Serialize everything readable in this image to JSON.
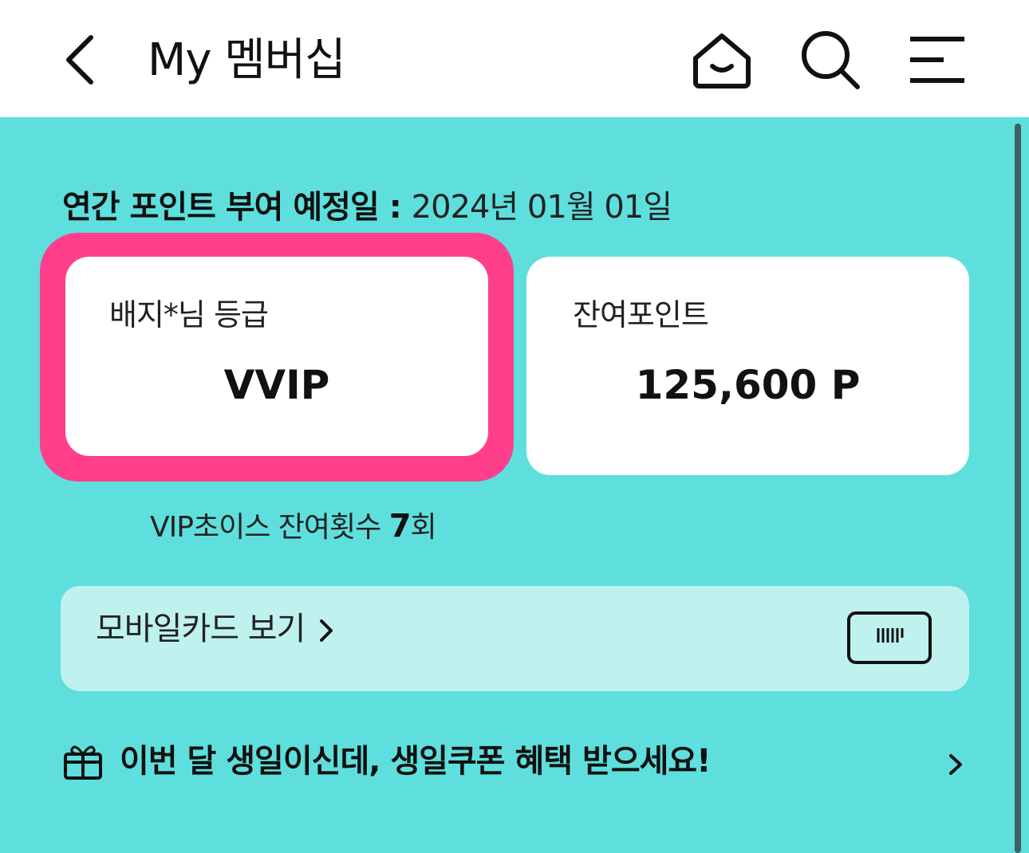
{
  "header": {
    "title": "My 멤버십",
    "back_icon": "chevron-left-icon",
    "home_icon": "home-icon",
    "search_icon": "search-icon",
    "menu_icon": "hamburger-menu-icon"
  },
  "schedule": {
    "label": "연간 포인트 부여 예정일 : ",
    "date": "2024년 01월 01일"
  },
  "grade_card": {
    "label": "배지*님 등급",
    "value": "VVIP",
    "highlight_color": "#ff3f8c"
  },
  "points_card": {
    "label": "잔여포인트",
    "value": "125,600 P"
  },
  "vip_choice": {
    "prefix": "VIP초이스 잔여횟수 ",
    "count": "7",
    "suffix": "회"
  },
  "mobile_card": {
    "label": "모바일카드 보기",
    "arrow_icon": "chevron-right-icon",
    "barcode_icon": "barcode-icon"
  },
  "birthday": {
    "text": "이번 달 생일이신데, 생일쿠폰 혜택 받으세요!",
    "gift_icon": "gift-icon",
    "arrow_icon": "chevron-right-icon"
  },
  "colors": {
    "background": "#5edfdd",
    "card": "#ffffff",
    "mobile_card": "#bff1ef",
    "highlight": "#ff3f8c"
  }
}
